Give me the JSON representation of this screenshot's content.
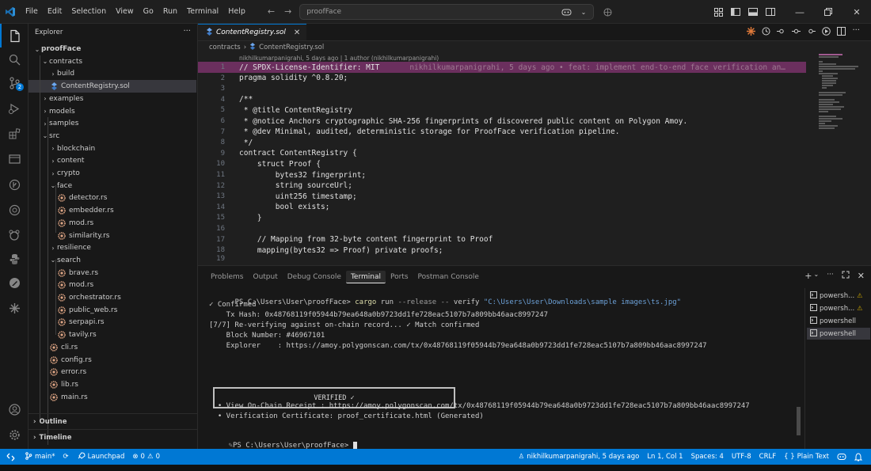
{
  "titlebar": {
    "menu": [
      "File",
      "Edit",
      "Selection",
      "View",
      "Go",
      "Run",
      "Terminal",
      "Help"
    ],
    "search_text": "proofFace"
  },
  "activity_badge": "2",
  "sidebar": {
    "title": "Explorer",
    "more": "···",
    "tree": [
      {
        "label": "proofFace",
        "depth": 0,
        "type": "folder-open",
        "bold": true
      },
      {
        "label": "contracts",
        "depth": 1,
        "type": "folder-open"
      },
      {
        "label": "build",
        "depth": 2,
        "type": "folder"
      },
      {
        "label": "ContentRegistry.sol",
        "depth": 2,
        "type": "file-sol",
        "selected": true
      },
      {
        "label": "examples",
        "depth": 1,
        "type": "folder"
      },
      {
        "label": "models",
        "depth": 1,
        "type": "folder"
      },
      {
        "label": "samples",
        "depth": 1,
        "type": "folder"
      },
      {
        "label": "src",
        "depth": 1,
        "type": "folder-open"
      },
      {
        "label": "blockchain",
        "depth": 2,
        "type": "folder"
      },
      {
        "label": "content",
        "depth": 2,
        "type": "folder"
      },
      {
        "label": "crypto",
        "depth": 2,
        "type": "folder"
      },
      {
        "label": "face",
        "depth": 2,
        "type": "folder-open"
      },
      {
        "label": "detector.rs",
        "depth": 3,
        "type": "file-rs"
      },
      {
        "label": "embedder.rs",
        "depth": 3,
        "type": "file-rs"
      },
      {
        "label": "mod.rs",
        "depth": 3,
        "type": "file-rs"
      },
      {
        "label": "similarity.rs",
        "depth": 3,
        "type": "file-rs"
      },
      {
        "label": "resilience",
        "depth": 2,
        "type": "folder"
      },
      {
        "label": "search",
        "depth": 2,
        "type": "folder-open"
      },
      {
        "label": "brave.rs",
        "depth": 3,
        "type": "file-rs"
      },
      {
        "label": "mod.rs",
        "depth": 3,
        "type": "file-rs"
      },
      {
        "label": "orchestrator.rs",
        "depth": 3,
        "type": "file-rs"
      },
      {
        "label": "public_web.rs",
        "depth": 3,
        "type": "file-rs"
      },
      {
        "label": "serpapi.rs",
        "depth": 3,
        "type": "file-rs"
      },
      {
        "label": "tavily.rs",
        "depth": 3,
        "type": "file-rs"
      },
      {
        "label": "cli.rs",
        "depth": 2,
        "type": "file-rs"
      },
      {
        "label": "config.rs",
        "depth": 2,
        "type": "file-rs"
      },
      {
        "label": "error.rs",
        "depth": 2,
        "type": "file-rs"
      },
      {
        "label": "lib.rs",
        "depth": 2,
        "type": "file-rs"
      },
      {
        "label": "main.rs",
        "depth": 2,
        "type": "file-rs"
      }
    ],
    "outline_label": "Outline",
    "timeline_label": "Timeline"
  },
  "editor": {
    "tab_label": "ContentRegistry.sol",
    "tab_close": "✕",
    "breadcrumb": [
      "contracts",
      "ContentRegistry.sol"
    ],
    "blame_header": "nikhilkumarpanigrahi, 5 days ago | 1 author (nikhilkumarpanigrahi)",
    "ghost_blame": "nikhilkumarpanigrahi, 5 days ago • feat: implement end-to-end face verification an…",
    "lines": [
      {
        "n": "1",
        "text": "// SPDX-License-Identifier: MIT"
      },
      {
        "n": "2",
        "text": "pragma solidity ^0.8.20;"
      },
      {
        "n": "3",
        "text": ""
      },
      {
        "n": "4",
        "text": "/**"
      },
      {
        "n": "5",
        "text": " * @title ContentRegistry"
      },
      {
        "n": "6",
        "text": " * @notice Anchors cryptographic SHA-256 fingerprints of discovered public content on Polygon Amoy."
      },
      {
        "n": "7",
        "text": " * @dev Minimal, audited, deterministic storage for ProofFace verification pipeline."
      },
      {
        "n": "8",
        "text": " */"
      },
      {
        "n": "9",
        "text": "contract ContentRegistry {"
      },
      {
        "n": "10",
        "text": "    struct Proof {"
      },
      {
        "n": "11",
        "text": "        bytes32 fingerprint;"
      },
      {
        "n": "12",
        "text": "        string sourceUrl;"
      },
      {
        "n": "13",
        "text": "        uint256 timestamp;"
      },
      {
        "n": "14",
        "text": "        bool exists;"
      },
      {
        "n": "15",
        "text": "    }"
      },
      {
        "n": "16",
        "text": ""
      },
      {
        "n": "17",
        "text": "    // Mapping from 32-byte content fingerprint to Proof"
      },
      {
        "n": "18",
        "text": "    mapping(bytes32 => Proof) private proofs;"
      },
      {
        "n": "19",
        "text": ""
      }
    ]
  },
  "panel": {
    "tabs": [
      "Problems",
      "Output",
      "Debug Console",
      "Terminal",
      "Ports",
      "Postman Console"
    ],
    "active_tab": "Terminal",
    "terminal": {
      "prompt_prefix": "PS C:\\Users\\User\\proofFace>",
      "cmd_cargo": "cargo",
      "cmd_run": "run",
      "cmd_flags": "--release --",
      "cmd_verify": "verify",
      "cmd_arg": "\"C:\\Users\\User\\Downloads\\sample images\\ts.jpg\"",
      "lines": [
        "✓ Confirmed",
        "    Tx Hash: 0x48768119f05944b79ea648a0b9723dd1fe728eac5107b7a809bb46aac8997247",
        "[7/7] Re-verifying against on-chain record... ✓ Match confirmed",
        "    Block Number: #46967101",
        "    Explorer    : https://amoy.polygonscan.com/tx/0x48768119f05944b79ea648a0b9723dd1fe728eac5107b7a809bb46aac8997247"
      ],
      "verified_text": "VERIFIED ✓",
      "bullets": [
        "  • View On-Chain Receipt : https://amoy.polygonscan.com/tx/0x48768119f05944b79ea648a0b9723dd1fe728eac5107b7a809bb46aac8997247",
        "  • Verification Certificate: proof_certificate.html (Generated)"
      ],
      "final_prompt": "PS C:\\Users\\User\\proofFace>"
    },
    "terminal_list": [
      {
        "label": "powersh...",
        "warn": true
      },
      {
        "label": "powersh...",
        "warn": true
      },
      {
        "label": "powershell",
        "warn": false
      },
      {
        "label": "powershell",
        "warn": false,
        "active": true
      }
    ]
  },
  "statusbar": {
    "branch": "main*",
    "launchpad": "Launchpad",
    "errors": "0",
    "warnings": "0",
    "blame": "nikhilkumarpanigrahi, 5 days ago",
    "position": "Ln 1, Col 1",
    "spaces": "Spaces: 4",
    "encoding": "UTF-8",
    "eol": "CRLF",
    "language": "Plain Text"
  },
  "colors": {
    "accent": "#0078d4",
    "highlight_line": "#6b2f5e",
    "rust_icon": "#dea584",
    "sol_icon": "#6da8f0",
    "warn": "#cca700"
  }
}
